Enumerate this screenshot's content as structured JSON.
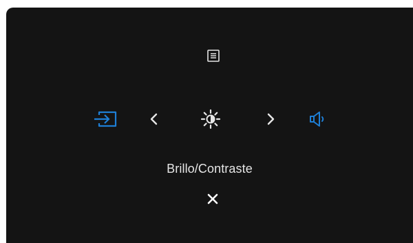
{
  "osd": {
    "current_function_label": "Brillo/Contraste",
    "icons": {
      "menu": "menu-icon",
      "input": "input-source-icon",
      "previous": "chevron-left-icon",
      "current": "brightness-contrast-icon",
      "next": "chevron-right-icon",
      "volume": "volume-icon",
      "close": "close-icon"
    },
    "colors": {
      "background": "#141414",
      "icon_default": "#e6e6e6",
      "accent": "#1e7fd6"
    }
  }
}
